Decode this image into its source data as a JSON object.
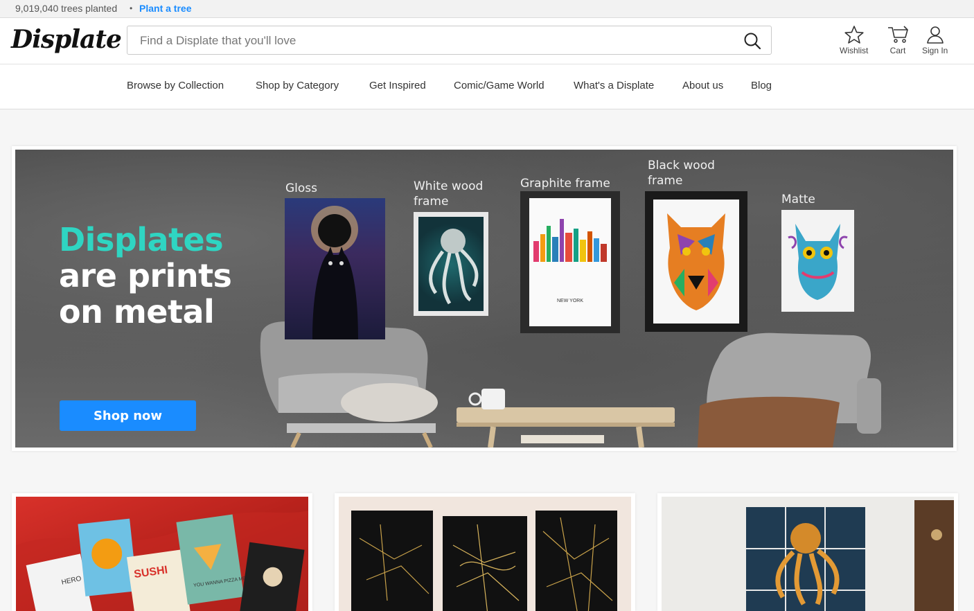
{
  "topbar": {
    "trees_text": "9,019,040 trees planted",
    "separator": "•",
    "plant_link": "Plant a tree"
  },
  "header": {
    "logo": "Displate",
    "search_placeholder": "Find a Displate that you'll love",
    "actions": {
      "wishlist": "Wishlist",
      "cart": "Cart",
      "signin": "Sign In"
    }
  },
  "nav": {
    "items": [
      "Browse by Collection",
      "Shop by Category",
      "Get Inspired",
      "Comic/Game World",
      "What's a Displate",
      "About us",
      "Blog"
    ]
  },
  "hero": {
    "title_accent": "Displates",
    "title_line2": "are prints",
    "title_line3": "on metal",
    "cta": "Shop now",
    "frames": {
      "gloss": "Gloss",
      "white_wood_1": "White wood",
      "white_wood_2": "frame",
      "graphite": "Graphite frame",
      "black_wood_1": "Black wood",
      "black_wood_2": "frame",
      "matte": "Matte"
    },
    "skyline_caption": "NEW YORK"
  },
  "cards": {
    "card1_text1": "HERO",
    "card1_text2": "SUSHI",
    "card1_text3": "YOU WANNA PIZZA ME"
  },
  "colors": {
    "accent_teal": "#2fd5c2",
    "brand_blue": "#1a8cff"
  }
}
